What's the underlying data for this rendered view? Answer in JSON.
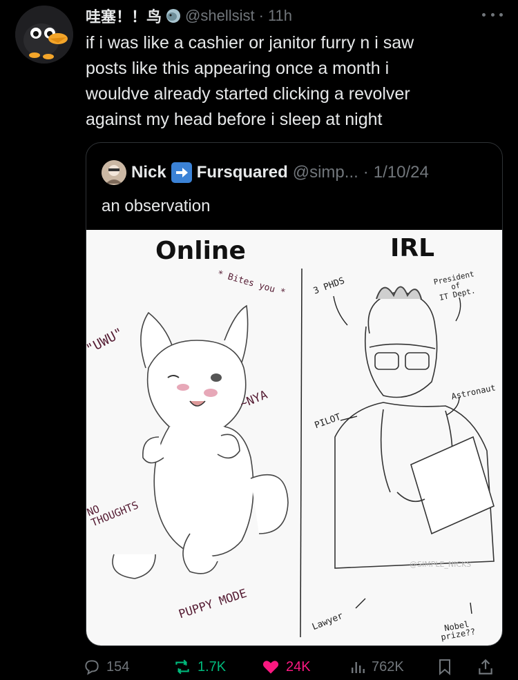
{
  "tweet": {
    "display_name": "哇塞！！鸟",
    "handle": "@shellsist",
    "separator": "·",
    "time": "11h",
    "text": "if i was like a cashier or janitor furry n i saw\nposts like this appearing once a month i\nwouldve already started clicking a revolver\nagainst my head before i sleep at night"
  },
  "quote": {
    "name_left": "Nick",
    "name_right": "Fursquared",
    "handle": "@simp...",
    "separator": "·",
    "date": "1/10/24",
    "text": "an observation",
    "art": {
      "heading_left": "Online",
      "heading_right": "IRL",
      "bites": "* Bites you *",
      "uwu": "\"UWU\"",
      "nya": "~NYA",
      "no_thoughts": "NO\nTHOUGHTS",
      "puppy_mode": "PUPPY MODE",
      "phds": "3 PHDS",
      "president": "President\nof\nIT Dept.",
      "astronaut": "Astronaut",
      "pilot": "PILOT",
      "lawyer": "Lawyer",
      "nobel": "Nobel\nprize??",
      "watermark": "@SIMPLE_NICKS"
    }
  },
  "actions": {
    "replies": "154",
    "reposts": "1.7K",
    "likes": "24K",
    "views": "762K"
  },
  "colors": {
    "background": "#000000",
    "text": "#e7e9ea",
    "muted": "#71767b",
    "repost_active": "#00ba7c",
    "like_active": "#f91880",
    "badge_blue": "#3b82d6"
  }
}
